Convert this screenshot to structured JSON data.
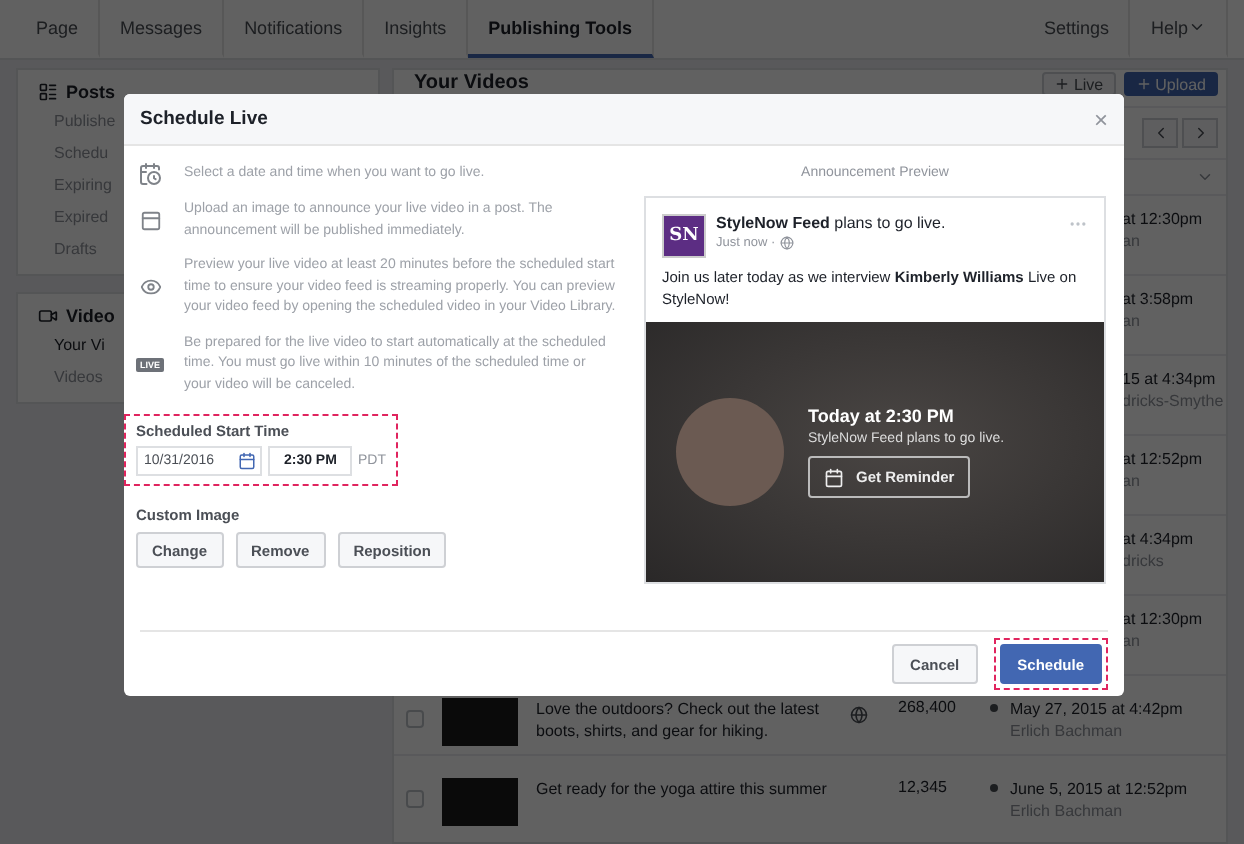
{
  "nav": {
    "tabs": [
      {
        "label": "Page",
        "selected": false
      },
      {
        "label": "Messages",
        "selected": false
      },
      {
        "label": "Notifications",
        "selected": false
      },
      {
        "label": "Insights",
        "selected": false
      },
      {
        "label": "Publishing Tools",
        "selected": true
      }
    ],
    "links": [
      {
        "label": "Settings",
        "kind": "link"
      },
      {
        "label": "Help",
        "kind": "dropdown"
      }
    ]
  },
  "sidebar": {
    "sections": [
      {
        "kind": "posts",
        "title": "Posts",
        "items": [
          {
            "label": "Publishe",
            "selected": false
          },
          {
            "label": "Schedu",
            "selected": false
          },
          {
            "label": "Expiring",
            "selected": false
          },
          {
            "label": "Expired",
            "selected": false
          },
          {
            "label": "Drafts",
            "selected": false
          }
        ]
      },
      {
        "kind": "video",
        "title": "Video",
        "items": [
          {
            "label": "Your Vi",
            "selected": true
          },
          {
            "label": "Videos",
            "selected": false
          }
        ]
      }
    ]
  },
  "library": {
    "title": "Your Videos",
    "buttons": [
      {
        "label": "Live",
        "primary": false
      },
      {
        "label": "Upload",
        "primary": true
      }
    ],
    "rows": [
      {
        "kind": "fragment",
        "date": "at 12:30pm",
        "author": "an"
      },
      {
        "kind": "fragment",
        "date": "at 3:58pm",
        "author": "an"
      },
      {
        "kind": "fragment",
        "date": "15 at 4:34pm",
        "author": "dricks-Smythe"
      },
      {
        "kind": "fragment",
        "date": "at 12:52pm",
        "author": "an"
      },
      {
        "kind": "fragment",
        "date": "at 4:34pm",
        "author": "dricks"
      },
      {
        "kind": "fragment",
        "date": "at 12:30pm",
        "author": "an"
      },
      {
        "kind": "video",
        "title": "Love the outdoors? Check out the latest boots, shirts, and gear for hiking.",
        "checked": false,
        "globe": true,
        "views": "268,400",
        "date": "May 27, 2015 at 4:42pm",
        "author": "Erlich Bachman"
      },
      {
        "kind": "video",
        "title": "Get ready for the yoga attire this summer",
        "checked": false,
        "globe": false,
        "views": "12,345",
        "date": "June 5, 2015 at 12:52pm",
        "author": "Erlich Bachman"
      }
    ]
  },
  "modal": {
    "title": "Schedule Live",
    "close": "×",
    "instructions": [
      {
        "kind": "calendar",
        "text": "Select a date and time when you want to go live."
      },
      {
        "kind": "image",
        "text": "Upload an image to announce your live video in a post. The announcement will be published immediately."
      },
      {
        "kind": "eye",
        "text": "Preview your live video at least 20 minutes before the scheduled start time to ensure your video feed is streaming properly. You can preview your video feed by opening the scheduled video in your Video Library."
      },
      {
        "kind": "live",
        "badge": "LIVE",
        "text": "Be prepared for the live video to start automatically at the scheduled time. You must go live within 10 minutes of the scheduled time or your video will be canceled."
      }
    ],
    "schedule": {
      "label": "Scheduled Start Time",
      "date": "10/31/2016",
      "time": "2:30 PM",
      "timezone": "PDT",
      "highlighted": true
    },
    "custom_image": {
      "label": "Custom Image",
      "buttons": [
        "Change",
        "Remove",
        "Reposition"
      ]
    },
    "preview": {
      "heading": "Announcement Preview",
      "logo": "SN",
      "headline": "**StyleNow Feed** plans to go live.",
      "meta": "Just now ·",
      "message": "Join us later today as we interview **Kimberly Williams** Live on StyleNow!",
      "event_time": "Today at 2:30 PM",
      "event_text": "StyleNow Feed plans to go live.",
      "reminder_button": "Get Reminder"
    },
    "footer": {
      "buttons": [
        {
          "label": "Cancel",
          "primary": false,
          "highlighted": false
        },
        {
          "label": "Schedule",
          "primary": true,
          "highlighted": true
        }
      ]
    }
  }
}
